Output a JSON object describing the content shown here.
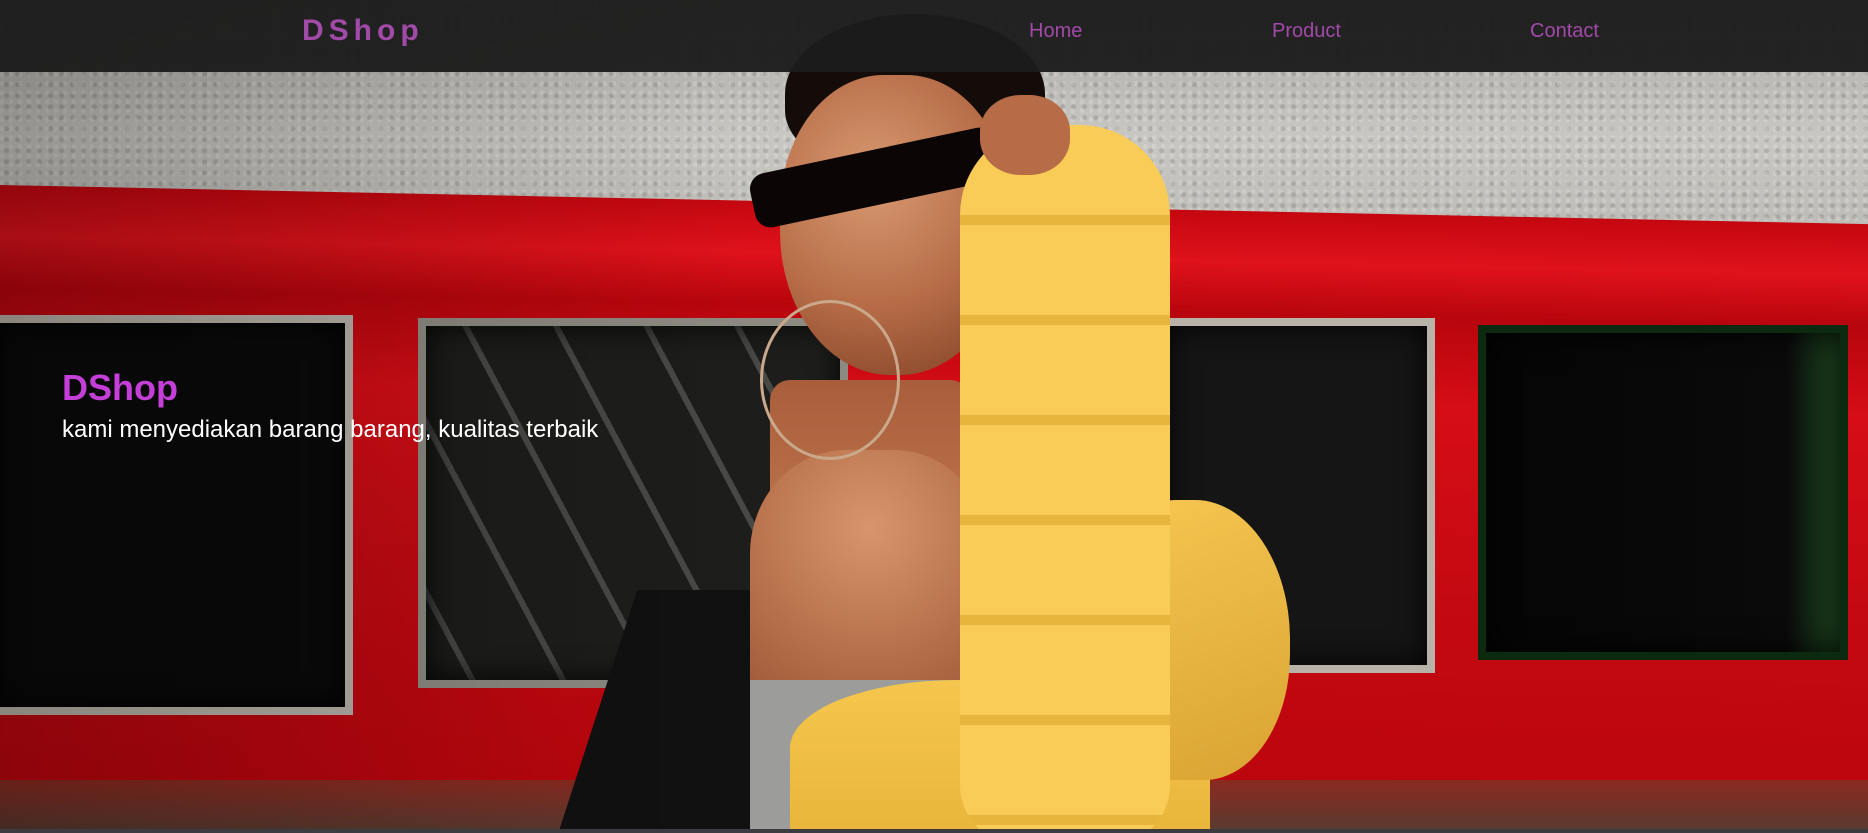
{
  "navbar": {
    "brand": "DShop",
    "links": [
      {
        "label": "Home"
      },
      {
        "label": "Product"
      },
      {
        "label": "Contact"
      }
    ]
  },
  "hero": {
    "title": "DShop",
    "subtitle": "kami menyediakan barang barang, kualitas terbaik",
    "image": "woman-yellow-jacket-sunglasses-photo"
  },
  "colors": {
    "brand": "#a14aa8",
    "hero_title": "#c43fd8",
    "navbar_bg": "#1c1c1c"
  }
}
